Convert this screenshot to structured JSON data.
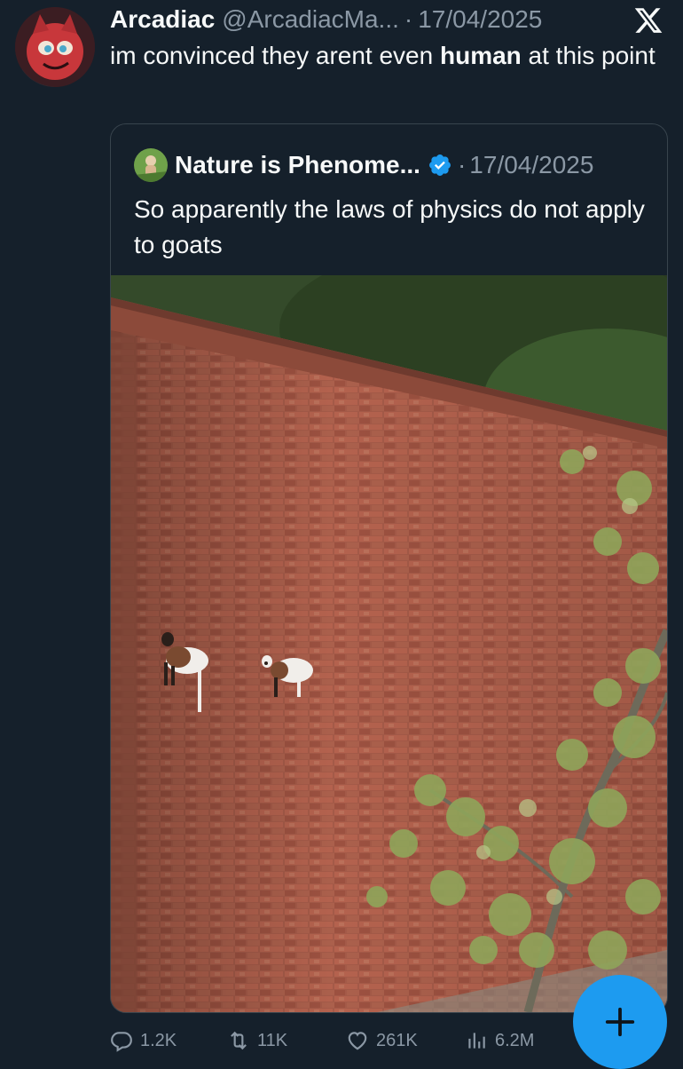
{
  "tweet": {
    "author_name": "Arcadiac",
    "handle": "@ArcadiacMa...",
    "separator": "·",
    "date": "17/04/2025",
    "text_before": "im convinced they arent even ",
    "text_bold": "human",
    "text_after": " at this point"
  },
  "quoted_tweet": {
    "author_name": "Nature is Phenome...",
    "separator": "·",
    "date": "17/04/2025",
    "text": "So apparently the laws of physics do not apply to goats"
  },
  "actions": {
    "replies": "1.2K",
    "reposts": "11K",
    "likes": "261K",
    "views": "6.2M"
  },
  "icons": {
    "platform_logo": "x-logo-icon",
    "verified": "verified-badge-icon",
    "reply": "reply-icon",
    "repost": "repost-icon",
    "like": "heart-icon",
    "views": "views-chart-icon",
    "compose": "plus-icon"
  },
  "colors": {
    "background": "#15202b",
    "text": "#f7f9f9",
    "secondary_text": "#8b98a5",
    "accent": "#1d9bf0",
    "border": "#38444d"
  }
}
